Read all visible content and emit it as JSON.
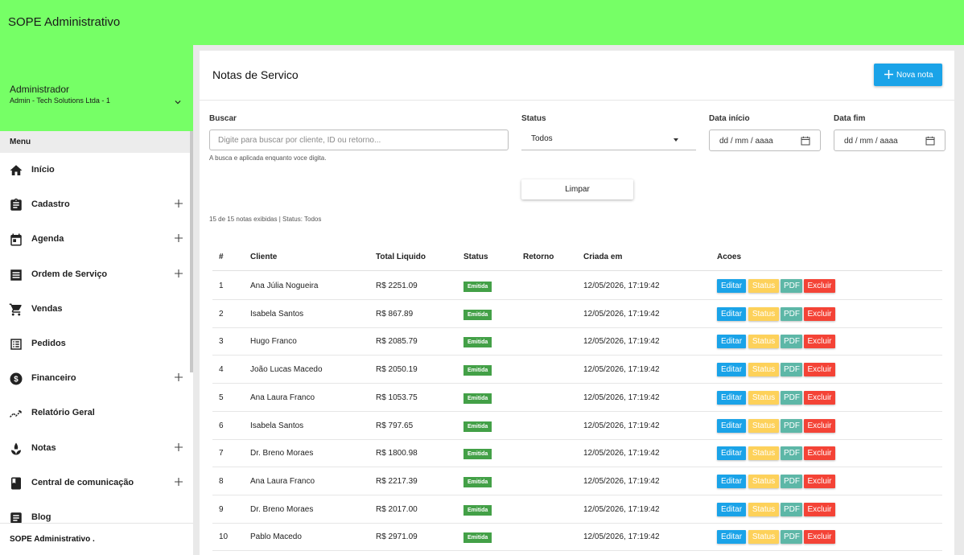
{
  "app": {
    "title": "SOPE Administrativo",
    "accent": "#76ff66"
  },
  "user": {
    "name": "Administrador",
    "company": "Admin - Tech Solutions Ltda - 1"
  },
  "sidebar": {
    "menu_header": "Menu",
    "items": [
      {
        "label": "Início",
        "icon": "home-icon",
        "expandable": false
      },
      {
        "label": "Cadastro",
        "icon": "clipboard-icon",
        "expandable": true
      },
      {
        "label": "Agenda",
        "icon": "calendar-icon",
        "expandable": true
      },
      {
        "label": "Ordem de Serviço",
        "icon": "list-box-icon",
        "expandable": true
      },
      {
        "label": "Vendas",
        "icon": "cart-icon",
        "expandable": false
      },
      {
        "label": "Pedidos",
        "icon": "list-icon",
        "expandable": false
      },
      {
        "label": "Financeiro",
        "icon": "dollar-icon",
        "expandable": true
      },
      {
        "label": "Relatório Geral",
        "icon": "chart-line-icon",
        "expandable": false
      },
      {
        "label": "Notas",
        "icon": "spa-icon",
        "expandable": true
      },
      {
        "label": "Central de comunicação",
        "icon": "book-icon",
        "expandable": true
      },
      {
        "label": "Blog",
        "icon": "article-icon",
        "expandable": false
      }
    ],
    "footer": "SOPE Administrativo ."
  },
  "page": {
    "title": "Notas de Servico",
    "new_button": "Nova nota"
  },
  "filters": {
    "search_label": "Buscar",
    "search_placeholder": "Digite para buscar por cliente, ID ou retorno...",
    "search_hint": "A busca e aplicada enquanto voce digita.",
    "status_label": "Status",
    "status_value": "Todos",
    "start_label": "Data início",
    "start_value": "dd / mm / aaaa",
    "end_label": "Data fim",
    "end_value": "dd / mm / aaaa",
    "clear_button": "Limpar",
    "summary": "15 de 15 notas exibidas | Status: Todos"
  },
  "table": {
    "headers": [
      "#",
      "Cliente",
      "Total Liquido",
      "Status",
      "Retorno",
      "Criada em",
      "Acoes"
    ],
    "actions": {
      "edit": "Editar",
      "status": "Status",
      "pdf": "PDF",
      "delete": "Excluir"
    },
    "rows": [
      {
        "id": "1",
        "client": "Ana Júlia Nogueira",
        "total": "R$ 2251.09",
        "status": "Emitida",
        "return": "",
        "created": "12/05/2026, 17:19:42"
      },
      {
        "id": "2",
        "client": "Isabela Santos",
        "total": "R$ 867.89",
        "status": "Emitida",
        "return": "",
        "created": "12/05/2026, 17:19:42"
      },
      {
        "id": "3",
        "client": "Hugo Franco",
        "total": "R$ 2085.79",
        "status": "Emitida",
        "return": "",
        "created": "12/05/2026, 17:19:42"
      },
      {
        "id": "4",
        "client": "João Lucas Macedo",
        "total": "R$ 2050.19",
        "status": "Emitida",
        "return": "",
        "created": "12/05/2026, 17:19:42"
      },
      {
        "id": "5",
        "client": "Ana Laura Franco",
        "total": "R$ 1053.75",
        "status": "Emitida",
        "return": "",
        "created": "12/05/2026, 17:19:42"
      },
      {
        "id": "6",
        "client": "Isabela Santos",
        "total": "R$ 797.65",
        "status": "Emitida",
        "return": "",
        "created": "12/05/2026, 17:19:42"
      },
      {
        "id": "7",
        "client": "Dr. Breno Moraes",
        "total": "R$ 1800.98",
        "status": "Emitida",
        "return": "",
        "created": "12/05/2026, 17:19:42"
      },
      {
        "id": "8",
        "client": "Ana Laura Franco",
        "total": "R$ 2217.39",
        "status": "Emitida",
        "return": "",
        "created": "12/05/2026, 17:19:42"
      },
      {
        "id": "9",
        "client": "Dr. Breno Moraes",
        "total": "R$ 2017.00",
        "status": "Emitida",
        "return": "",
        "created": "12/05/2026, 17:19:42"
      },
      {
        "id": "10",
        "client": "Pablo Macedo",
        "total": "R$ 2971.09",
        "status": "Emitida",
        "return": "",
        "created": "12/05/2026, 17:19:42"
      }
    ]
  }
}
